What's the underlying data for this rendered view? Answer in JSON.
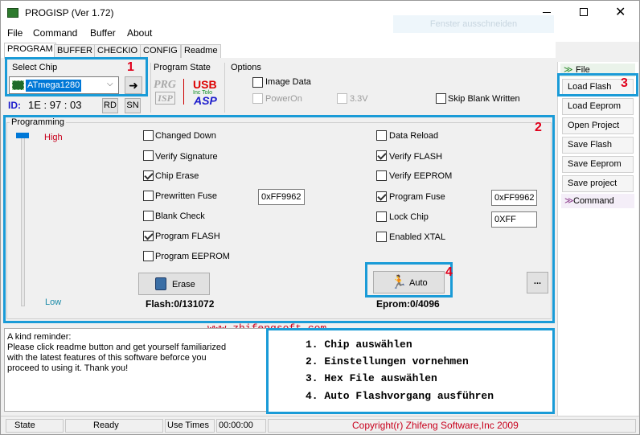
{
  "window": {
    "title": "PROGISP (Ver 1.72)",
    "watermark": "Fenster ausschneiden"
  },
  "menu": [
    "File",
    "Command",
    "Buffer",
    "About"
  ],
  "tabs": [
    "PROGRAM",
    "BUFFER",
    "CHECKIO",
    "CONFIG",
    "Readme"
  ],
  "select_chip": {
    "label": "Select Chip",
    "chip": "ATmega1280",
    "id_label": "ID:",
    "id_value": "1E : 97 : 03",
    "rd": "RD",
    "sn": "SN"
  },
  "program_state": {
    "label": "Program State",
    "prg": "PRG",
    "isp": "ISP",
    "usb": "USB",
    "usb_sub": "Inc   Tolo",
    "asp": "ASP"
  },
  "options": {
    "label": "Options",
    "image_data": "Image Data",
    "poweron": "PowerOn",
    "v33": "3.3V",
    "skip_blank": "Skip Blank Written"
  },
  "programming": {
    "label": "Programming",
    "high": "High",
    "low": "Low",
    "left": [
      {
        "label": "Changed Down",
        "checked": false
      },
      {
        "label": "Verify Signature",
        "checked": false
      },
      {
        "label": "Chip Erase",
        "checked": true
      },
      {
        "label": "Prewritten Fuse",
        "checked": false
      },
      {
        "label": "Blank Check",
        "checked": false
      },
      {
        "label": "Program FLASH",
        "checked": true
      },
      {
        "label": "Program EEPROM",
        "checked": false
      }
    ],
    "right": [
      {
        "label": "Data Reload",
        "checked": false
      },
      {
        "label": "Verify FLASH",
        "checked": true
      },
      {
        "label": "Verify EEPROM",
        "checked": false
      },
      {
        "label": "Program Fuse",
        "checked": true
      },
      {
        "label": "Lock Chip",
        "checked": false
      },
      {
        "label": "Enabled XTAL",
        "checked": false
      }
    ],
    "prewritten_fuse_value": "0xFF9962",
    "program_fuse_value": "0xFF9962",
    "lock_chip_value": "0XFF",
    "erase_label": "Erase",
    "auto_label": "Auto",
    "more_label": "...",
    "flash_info": "Flash:0/131072",
    "eprom_info": "Eprom:0/4096"
  },
  "side": {
    "file_header": "File",
    "buttons": [
      "Load Flash",
      "Load Eeprom",
      "Open Project",
      "Save Flash",
      "Save Eeprom",
      "Save project"
    ],
    "command_header": "Command"
  },
  "watermark_url": "www.zhifengsoft.com",
  "reminder": {
    "title": "A kind reminder:",
    "line1": "Please click readme button and get yourself familiarized",
    "line2": "with the latest features of this software beforce you",
    "line3": "proceed to using it. Thank you!"
  },
  "steps": [
    "1. Chip auswählen",
    "2. Einstellungen vornehmen",
    "3. Hex File auswählen",
    "4. Auto Flashvorgang ausführen"
  ],
  "annotations": [
    "1",
    "2",
    "3",
    "4"
  ],
  "status": {
    "state": "State",
    "ready": "Ready",
    "use_times": "Use Times",
    "time": "00:00:00",
    "copyright": "Copyright(r) Zhifeng Software,Inc 2009"
  },
  "colors": {
    "annotation_blue": "#1a9bd7",
    "annotation_red": "#e0001b",
    "copyright_red": "#c8001c",
    "chip_select_blue": "#0078d7"
  },
  "icons": [
    "chip-icon",
    "arrow-right-icon",
    "minimize-icon",
    "maximize-icon",
    "close-icon",
    "erase-icon",
    "auto-runner-icon"
  ]
}
